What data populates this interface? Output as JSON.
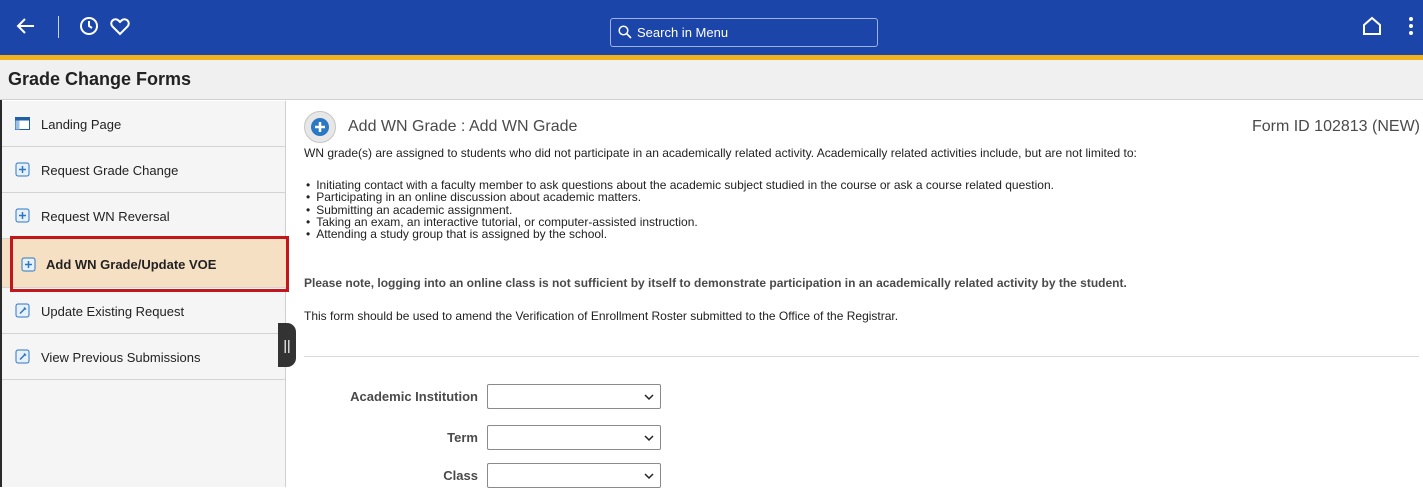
{
  "topbar": {
    "search_placeholder": "Search in Menu",
    "icons": [
      "back-arrow-icon",
      "history-icon",
      "favorites-heart-icon",
      "search-icon",
      "home-icon",
      "more-vertical-icon"
    ]
  },
  "page_title": "Grade Change Forms",
  "sidebar": {
    "items": [
      {
        "label": "Landing Page",
        "icon": "landing-page-icon"
      },
      {
        "label": "Request Grade Change",
        "icon": "form-icon"
      },
      {
        "label": "Request WN Reversal",
        "icon": "form-icon"
      },
      {
        "label": "Add WN Grade/Update VOE",
        "icon": "form-icon",
        "active": true
      },
      {
        "label": "Update Existing Request",
        "icon": "form-icon"
      },
      {
        "label": "View Previous Submissions",
        "icon": "form-icon"
      }
    ]
  },
  "main": {
    "heading": "Add WN Grade : Add WN Grade",
    "form_id": "Form ID 102813 (NEW)",
    "intro": "WN grade(s) are assigned to students who did not participate in an academically related activity.  Academically related activities include, but are not limited to:",
    "bullets": [
      "Initiating contact with a faculty member to ask questions about the academic subject studied in the course or ask a course related question.",
      "Participating in an online discussion about academic matters.",
      "Submitting an academic assignment.",
      "Taking an exam, an interactive tutorial, or computer-assisted instruction.",
      "Attending a study group that is assigned by the school."
    ],
    "note": "Please note, logging into an online class is not sufficient by itself to demonstrate participation in an academically related activity by the student.",
    "form_note": "This form should be used to amend the Verification of Enrollment Roster submitted to the Office of the Registrar.",
    "fields": [
      {
        "label": "Academic Institution",
        "value": ""
      },
      {
        "label": "Term",
        "value": ""
      },
      {
        "label": "Class",
        "value": ""
      }
    ]
  },
  "colors": {
    "topbar": "#1b45a8",
    "gold_accent": "#f1b21d",
    "active_item": "#f6e0c4",
    "highlight_border": "#c3151c"
  }
}
